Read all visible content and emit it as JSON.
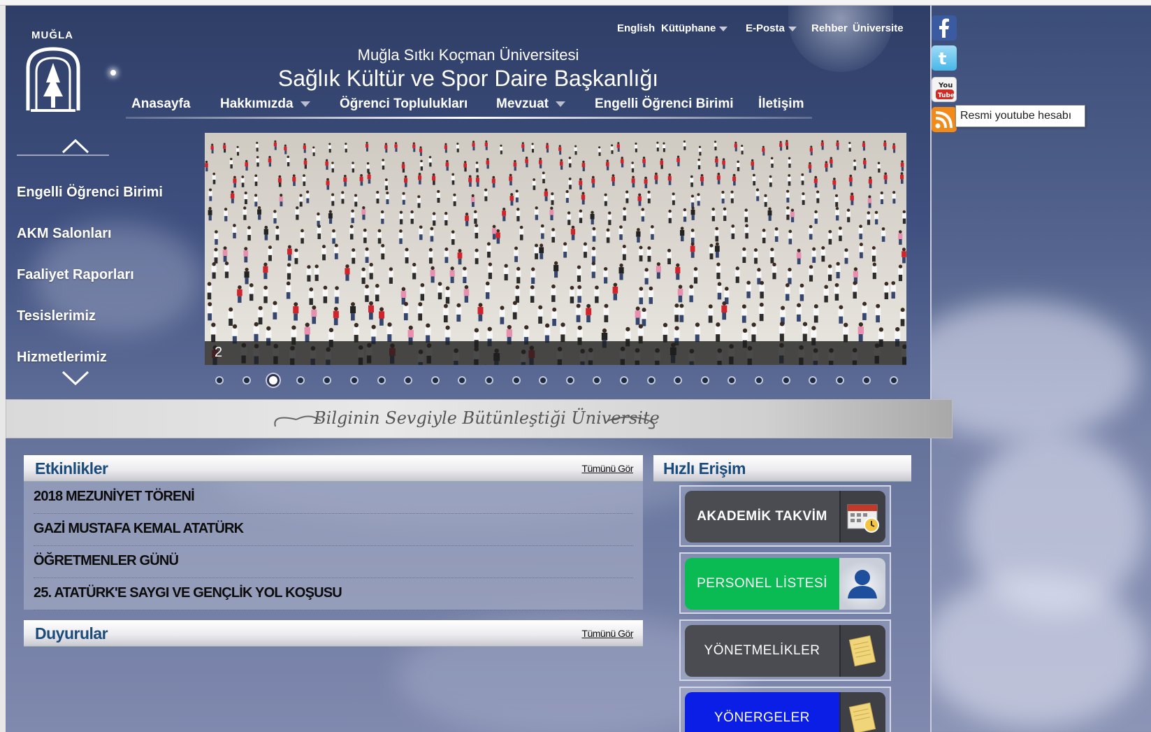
{
  "header": {
    "logo_text": "MUĞLA",
    "university": "Muğla Sıtkı Koçman Üniversitesi",
    "department": "Sağlık Kültür ve Spor Daire Başkanlığı",
    "top_links": [
      "English",
      "Kütüphane",
      "E-Posta",
      "Rehber",
      "Üniversite"
    ]
  },
  "nav": {
    "items": [
      "Anasayfa",
      "Hakkımızda",
      "Öğrenci Toplulukları",
      "Mevzuat",
      "Engelli Öğrenci Birimi",
      "İletişim"
    ]
  },
  "side_menu": {
    "items": [
      "Engelli Öğrenci Birimi",
      "AKM Salonları",
      "Faaliyet Raporları",
      "Tesislerimiz",
      "Hizmetlerimiz"
    ]
  },
  "slider": {
    "current_slide": "2",
    "total_dots": 26,
    "active_index": 2
  },
  "slogan": "Bilginin Sevgiyle Bütünleştiği Üniversite",
  "events": {
    "title": "Etkinlikler",
    "see_all": "Tümünü Gör",
    "items": [
      "2018 MEZUNİYET TÖRENİ",
      "GAZİ MUSTAFA KEMAL ATATÜRK",
      "ÖĞRETMENLER GÜNÜ",
      "25. ATATÜRK'E SAYGI VE GENÇLİK YOL KOŞUSU"
    ]
  },
  "announcements": {
    "title": "Duyurular",
    "see_all": "Tümünü Gör"
  },
  "quick_access": {
    "title": "Hızlı Erişim",
    "buttons": [
      {
        "label": "AKADEMİK TAKVİM",
        "icon": "calendar-icon",
        "color": "#4a4c52"
      },
      {
        "label": "PERSONEL LİSTESİ",
        "icon": "person-icon",
        "color": "#0aba52"
      },
      {
        "label": "YÖNETMELİKLER",
        "icon": "document-icon",
        "color": "#4a4c52"
      },
      {
        "label": "YÖNERGELER",
        "icon": "document-icon",
        "color": "#0a1ee6"
      }
    ]
  },
  "social": {
    "icons": [
      "facebook-icon",
      "twitter-icon",
      "youtube-icon",
      "rss-icon"
    ],
    "tooltip": "Resmi youtube hesabı"
  }
}
